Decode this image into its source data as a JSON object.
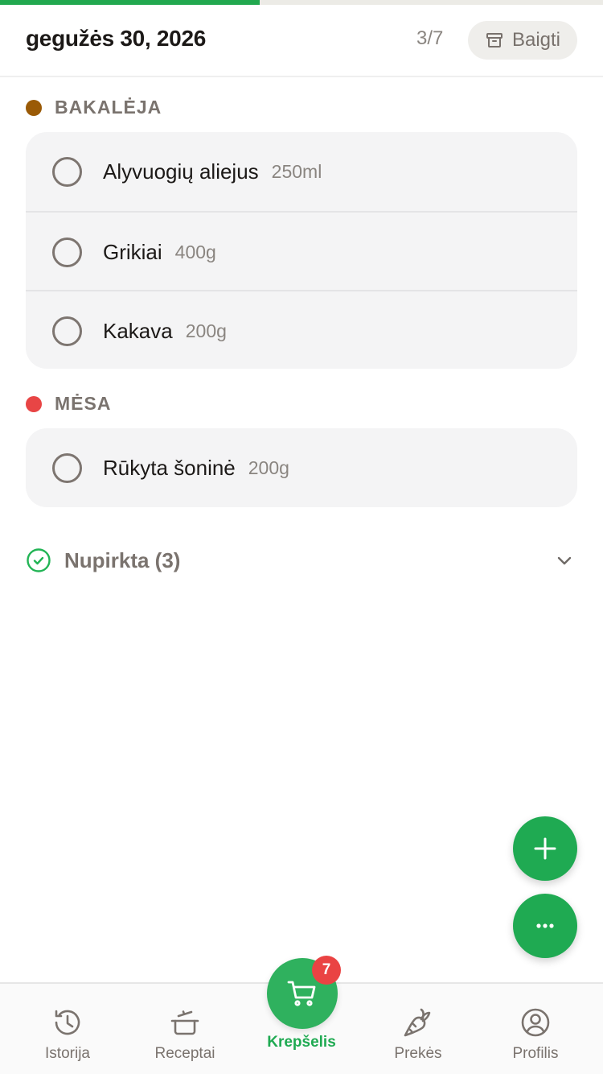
{
  "progress": {
    "done": 3,
    "total": 7,
    "fraction": 0.43
  },
  "header": {
    "title": "gegužės 30, 2026",
    "count": "3/7",
    "finish_label": "Baigti"
  },
  "sections": [
    {
      "label": "BAKALĖJA",
      "color": "#9a5a06",
      "items": [
        {
          "name": "Alyvuogių aliejus",
          "qty": "250ml",
          "checked": false
        },
        {
          "name": "Grikiai",
          "qty": "400g",
          "checked": false
        },
        {
          "name": "Kakava",
          "qty": "200g",
          "checked": false
        }
      ]
    },
    {
      "label": "MĖSA",
      "color": "#e84545",
      "items": [
        {
          "name": "Rūkyta šoninė",
          "qty": "200g",
          "checked": false
        }
      ]
    }
  ],
  "bought": {
    "label": "Nupirkta (3)"
  },
  "fabs": {
    "add_icon": "plus-icon",
    "more_icon": "more-icon"
  },
  "nav": {
    "items": [
      {
        "label": "Istorija",
        "icon": "history-icon"
      },
      {
        "label": "Receptai",
        "icon": "pot-icon"
      },
      {
        "label": "Krepšelis",
        "icon": "cart-icon",
        "active": true,
        "badge": "7"
      },
      {
        "label": "Prekės",
        "icon": "carrot-icon"
      },
      {
        "label": "Profilis",
        "icon": "profile-icon"
      }
    ]
  },
  "colors": {
    "accent": "#1faa52",
    "badge": "#ea4343",
    "muted": "#7a736e"
  }
}
